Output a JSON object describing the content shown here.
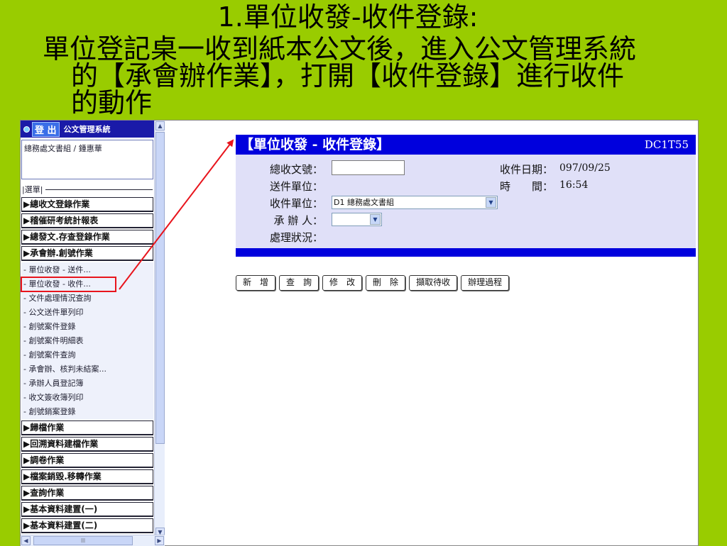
{
  "slide": {
    "title": "1.單位收發-收件登錄:",
    "line1": "單位登記桌一收到紙本公文後，進入公文管理系統",
    "line2": "的【承會辦作業】，打開【收件登錄】進行收件",
    "line3": "的動作"
  },
  "sidebar": {
    "logout_label": "登 出",
    "system_name": "公文管理系統",
    "user_info": "總務處文書組 / 鍾惠華",
    "menu_label": "|選單|",
    "categories_top": [
      {
        "label": "▶總收文登錄作業"
      },
      {
        "label": "▶稽催研考統計報表"
      },
      {
        "label": "▶總發文.存查登錄作業"
      },
      {
        "label": "▶承會辦.創號作業"
      }
    ],
    "sub_items": [
      {
        "label": "- 單位收發 - 送件..."
      },
      {
        "label": "- 單位收發 - 收件..."
      },
      {
        "label": "- 文件處理情況查詢"
      },
      {
        "label": "- 公文送件單列印"
      },
      {
        "label": "- 創號案件登錄"
      },
      {
        "label": "- 創號案件明細表"
      },
      {
        "label": "- 創號案件查詢"
      },
      {
        "label": "- 承會辦、核判未結案..."
      },
      {
        "label": "- 承辦人員登記簿"
      },
      {
        "label": "- 收文簽收簿列印"
      },
      {
        "label": "- 創號銷案登錄"
      }
    ],
    "categories_bottom": [
      {
        "label": "▶歸檔作業"
      },
      {
        "label": "▶回溯資料建檔作業"
      },
      {
        "label": "▶調卷作業"
      },
      {
        "label": "▶檔案銷毀.移轉作業"
      },
      {
        "label": "▶查詢作業"
      },
      {
        "label": "▶基本資料建置(一)"
      },
      {
        "label": "▶基本資料建置(二)"
      }
    ]
  },
  "form": {
    "title": "【單位收發 - 收件登錄】",
    "code": "DC1T55",
    "total_doc_no_label": "總收文號：",
    "total_doc_no_value": "",
    "sender_unit_label": "送件單位：",
    "receiver_unit_label": "收件單位：",
    "receiver_unit_value": "D1 總務處文書組",
    "handler_label": "承 辦 人：",
    "handler_value": "",
    "status_label": "處理狀況：",
    "recv_date_label": "收件日期：",
    "recv_date_value": "097/09/25",
    "time_label": "時　　間：",
    "time_value": "16:54"
  },
  "buttons": {
    "add": "新　增",
    "query": "查　詢",
    "edit": "修　改",
    "delete": "刪　除",
    "fetch_pending": "擷取待收",
    "process_history": "辦理過程"
  },
  "colors": {
    "slide_bg": "#99cc00",
    "header_blue": "#0000dd",
    "form_bg": "#e0e0f8",
    "highlight_red": "#e8141c"
  }
}
